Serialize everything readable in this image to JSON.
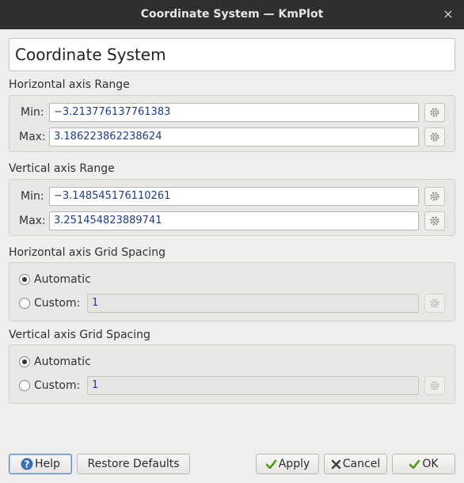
{
  "window": {
    "title": "Coordinate System — KmPlot",
    "close_glyph": "×"
  },
  "page_heading": "Coordinate System",
  "horizontal_range": {
    "title": "Horizontal axis Range",
    "min_label": "Min:",
    "min_value": "−3.213776137761383",
    "max_label": "Max:",
    "max_value": "3.186223862238624"
  },
  "vertical_range": {
    "title": "Vertical axis Range",
    "min_label": "Min:",
    "min_value": "−3.148545176110261",
    "max_label": "Max:",
    "max_value": "3.251454823889741"
  },
  "horizontal_grid": {
    "title": "Horizontal axis Grid Spacing",
    "automatic_label": "Automatic",
    "automatic_checked": true,
    "custom_label": "Custom:",
    "custom_value": "1"
  },
  "vertical_grid": {
    "title": "Vertical axis Grid Spacing",
    "automatic_label": "Automatic",
    "automatic_checked": true,
    "custom_label": "Custom:",
    "custom_value": "1"
  },
  "buttons": {
    "help": "Help",
    "restore_defaults": "Restore Defaults",
    "apply": "Apply",
    "cancel": "Cancel",
    "ok": "OK"
  },
  "icons": {
    "help": "help-icon",
    "apply": "checkmark-icon",
    "cancel": "cross-icon",
    "ok": "checkmark-icon",
    "edit": "gear-icon"
  },
  "colors": {
    "titlebar": "#302f2d",
    "field_text": "#1f3c88",
    "help_icon": "#3a6fb5",
    "check_icon": "#4e9a06"
  }
}
